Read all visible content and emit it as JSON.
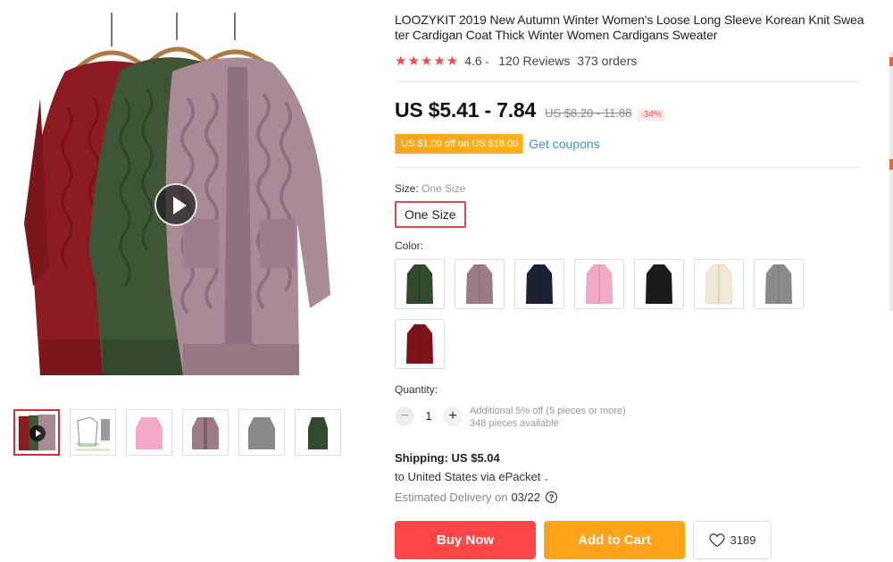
{
  "product": {
    "title": "LOOZYKIT 2019 New Autumn Winter Women's Loose Long Sleeve Korean Knit Sweater Cardigan Coat Thick Winter Women Cardigans Sweater",
    "rating": "4.6",
    "rating_stars": 5,
    "reviews": "120 Reviews",
    "orders": "373 orders"
  },
  "price": {
    "current": "US $5.41 - 7.84",
    "original": "US $8.20 - 11.88",
    "discount": "-34%"
  },
  "coupon": {
    "badge": "US $1.00 off on US $18.00",
    "link": "Get coupons"
  },
  "size": {
    "label": "Size:",
    "selected": "One Size",
    "option": "One Size"
  },
  "color": {
    "label": "Color:",
    "swatches": [
      {
        "name": "dark-green",
        "color": "#2f4a2c"
      },
      {
        "name": "mauve",
        "color": "#9c7a86"
      },
      {
        "name": "navy",
        "color": "#1c2233"
      },
      {
        "name": "pink",
        "color": "#f4a9c9"
      },
      {
        "name": "black",
        "color": "#1b1b1b"
      },
      {
        "name": "beige",
        "color": "#efe9d6"
      },
      {
        "name": "gray",
        "color": "#8a8a8a"
      },
      {
        "name": "wine-red",
        "color": "#7d1218"
      }
    ]
  },
  "quantity": {
    "label": "Quantity:",
    "value": "1",
    "note": "Additional 5% off (5 pieces or more)",
    "available": "348 pieces available"
  },
  "shipping": {
    "price_line": "Shipping: US $5.04",
    "destination": "to United States via ePacket",
    "delivery_label": "Estimated Delivery on",
    "delivery_date": "03/22"
  },
  "actions": {
    "buy_now": "Buy Now",
    "add_to_cart": "Add to Cart",
    "wishlist_count": "3189"
  },
  "gallery": {
    "thumbnails": [
      "video",
      "size-chart",
      "pink",
      "mauve",
      "gray",
      "dark-green"
    ]
  },
  "colors": {
    "accent_red": "#ff4747",
    "accent_orange": "#ffa31a",
    "link_blue": "#2e9cc3"
  }
}
